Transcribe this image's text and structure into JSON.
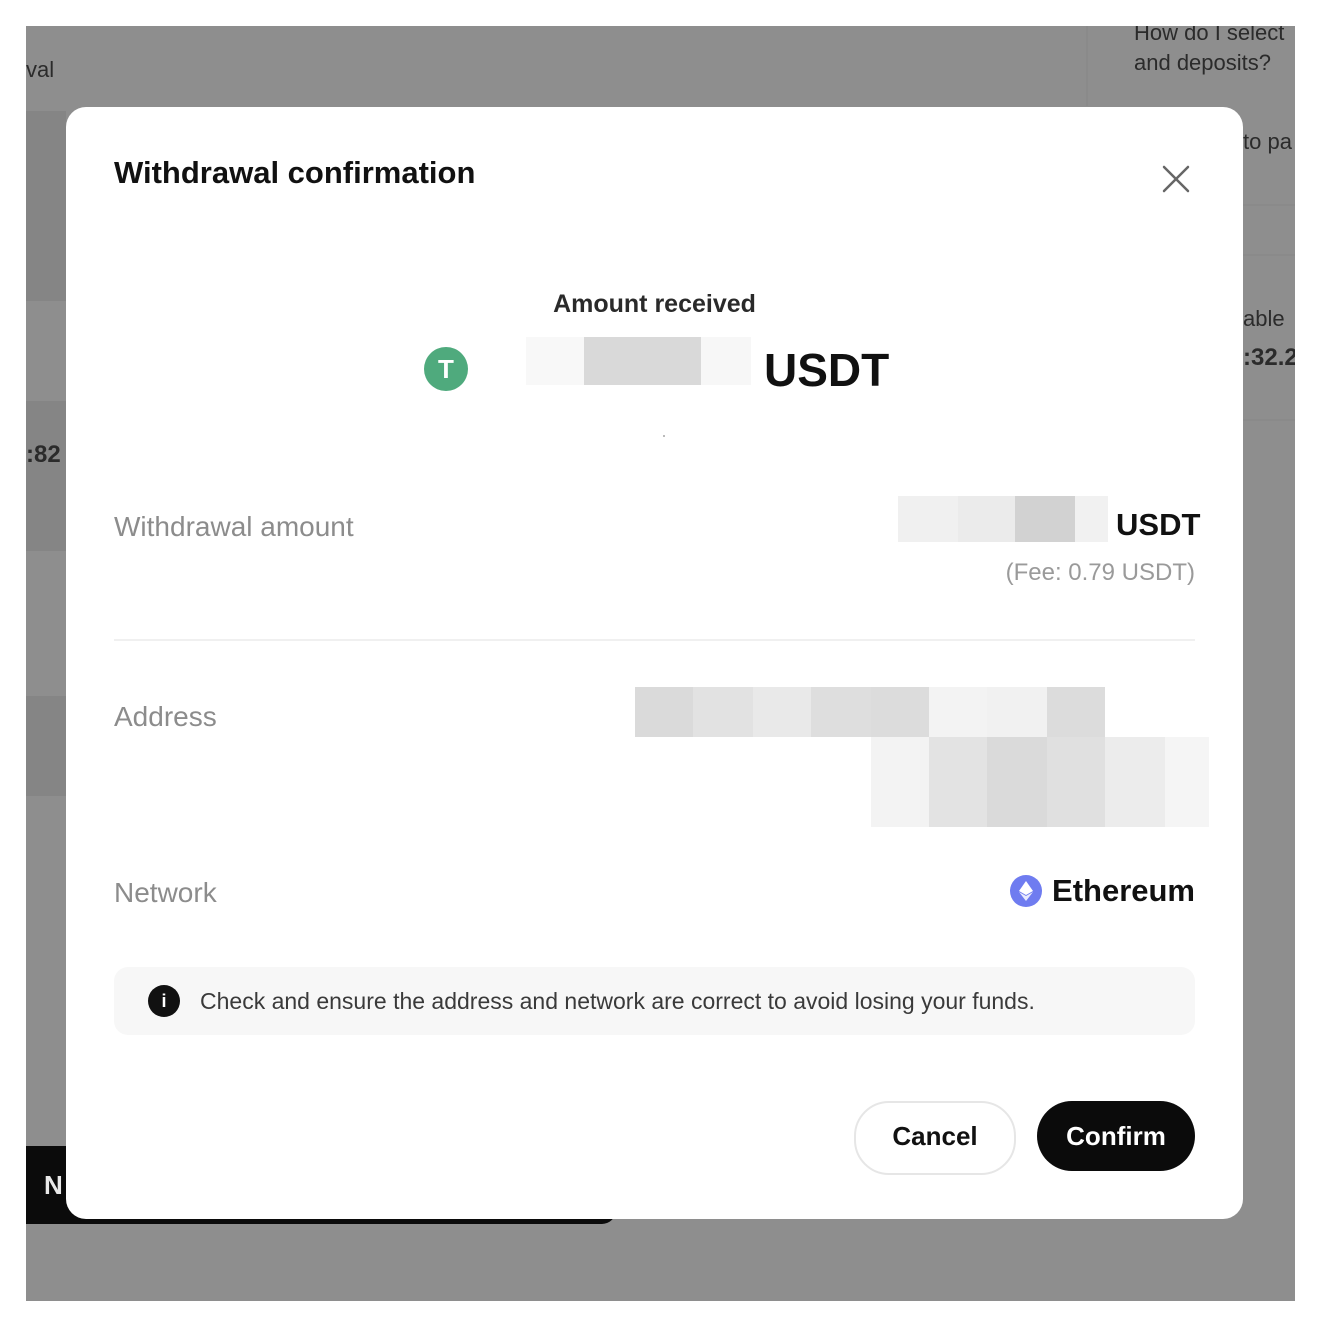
{
  "background": {
    "faq_line1": "How do I select",
    "faq_line2": "and deposits?",
    "frag_val": "val",
    "frag_to_pa": "to pa",
    "frag_able": "able",
    "frag_32": ":32.2",
    "frag_82": ":82",
    "dark_button_label": "N"
  },
  "modal": {
    "title": "Withdrawal confirmation",
    "close_icon": "close-icon",
    "amount_received_label": "Amount received",
    "coin_icon": "usdt-icon",
    "coin_letter": "T",
    "amount_unit": "USDT",
    "rows": {
      "withdrawal_amount_label": "Withdrawal amount",
      "withdrawal_amount_unit": "USDT",
      "fee_text": "(Fee: 0.79 USDT)",
      "address_label": "Address",
      "network_label": "Network",
      "network_value": "Ethereum",
      "network_icon": "ethereum-icon"
    },
    "notice": {
      "icon": "info-icon",
      "icon_glyph": "i",
      "text": "Check and ensure the address and network are correct to avoid losing your funds."
    },
    "buttons": {
      "cancel": "Cancel",
      "confirm": "Confirm"
    }
  },
  "colors": {
    "backdrop": "#8e8e8e",
    "usdt_green": "#4faa7d",
    "ethereum_purple": "#6f7cf0",
    "confirm_bg": "#0b0b0b"
  }
}
